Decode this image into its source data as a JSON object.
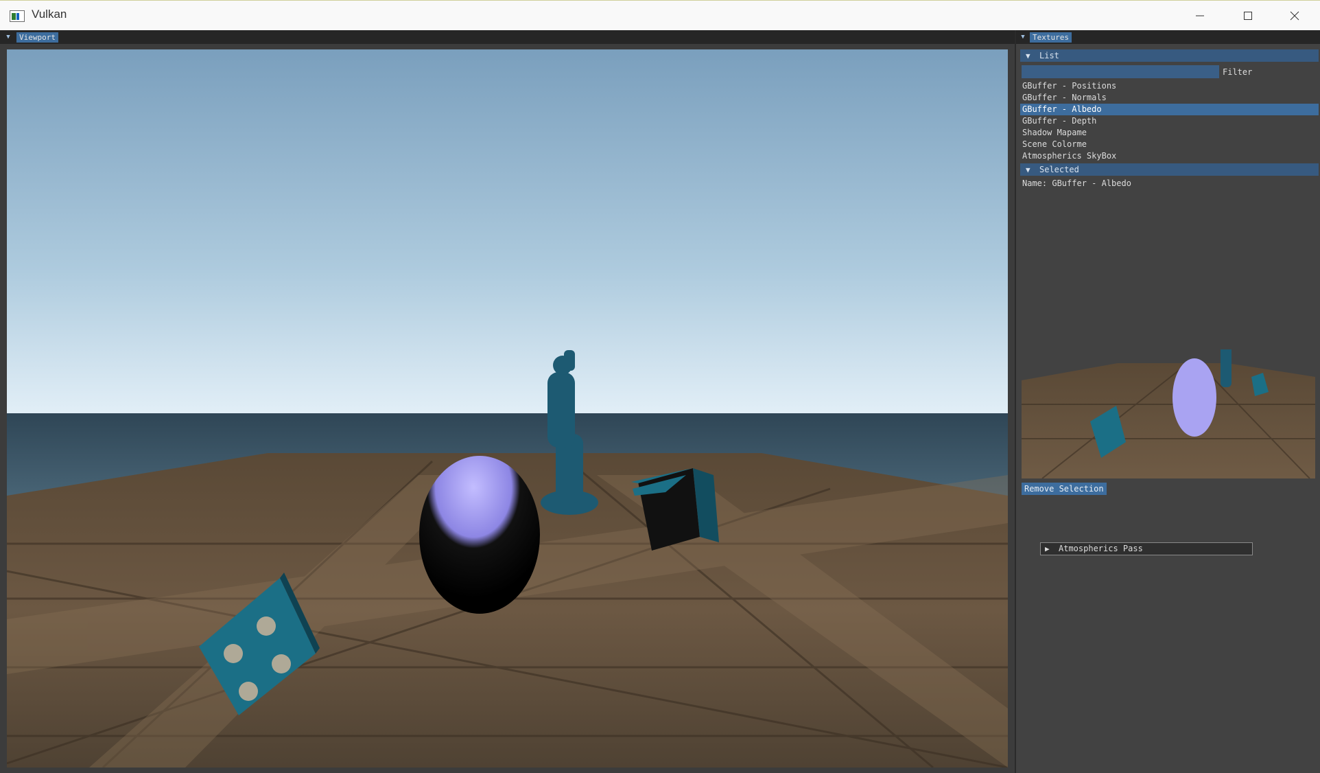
{
  "window": {
    "title": "Vulkan",
    "minimize_icon": "minimize-icon",
    "maximize_icon": "maximize-icon",
    "close_icon": "close-icon"
  },
  "viewport_panel": {
    "tab_label": "Viewport",
    "scene": {
      "sky_top": "#7a9fbd",
      "sky_horizon": "#e4f0f8",
      "sea": "#3f5a6e",
      "floor": "#5f4d3a",
      "sphere": "#a9a3f2",
      "statue": "#1d5a72",
      "cube": "#1b6f86"
    }
  },
  "textures_panel": {
    "tab_label": "Textures",
    "list_section": {
      "header": "List",
      "filter_label": "Filter",
      "filter_value": "",
      "items": [
        "GBuffer - Positions",
        "GBuffer - Normals",
        "GBuffer - Albedo",
        "GBuffer - Depth",
        "Shadow Mapame",
        "Scene Colorme",
        "Atmospherics SkyBox"
      ],
      "selected_index": 2
    },
    "selected_section": {
      "header": "Selected",
      "name_line": "Name: GBuffer - Albedo"
    },
    "remove_button": "Remove Selection",
    "atmospherics_pass": "Atmospherics Pass"
  },
  "colors": {
    "accent": "#3d6d9e",
    "header": "#375a80",
    "panel_bg": "#424242",
    "dock_bar": "#262626"
  }
}
